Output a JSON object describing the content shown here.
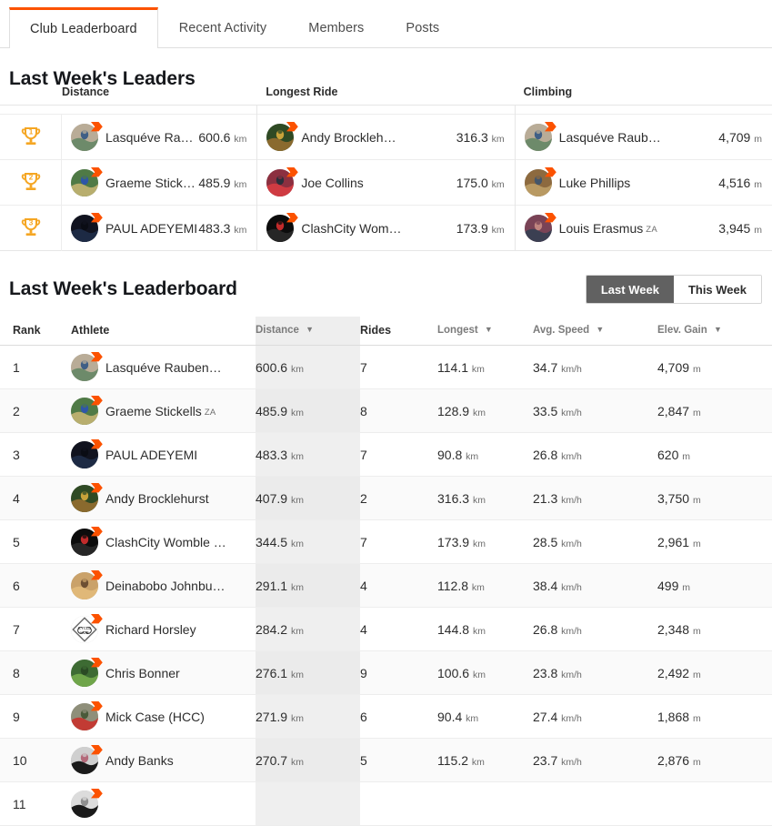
{
  "tabs": [
    {
      "label": "Club Leaderboard",
      "active": true
    },
    {
      "label": "Recent Activity",
      "active": false
    },
    {
      "label": "Members",
      "active": false
    },
    {
      "label": "Posts",
      "active": false
    }
  ],
  "leaders": {
    "title": "Last Week's Leaders",
    "columns": [
      {
        "header": "Distance",
        "unit": "km",
        "rows": [
          {
            "rank": 1,
            "name": "Lasquéve Raub…",
            "country": "",
            "value": "600.6",
            "unit": "km",
            "avatar": "road-cyclist"
          },
          {
            "rank": 2,
            "name": "Graeme Stickel…",
            "country": "",
            "value": "485.9",
            "unit": "km",
            "avatar": "group-ride"
          },
          {
            "rank": 3,
            "name": "PAUL ADEYEMI",
            "country": "",
            "value": "483.3",
            "unit": "km",
            "avatar": "dark-portrait"
          }
        ]
      },
      {
        "header": "Longest Ride",
        "unit": "km",
        "rows": [
          {
            "rank": 1,
            "name": "Andy Brockleh…",
            "country": "",
            "value": "316.3",
            "unit": "km",
            "avatar": "green-helmet"
          },
          {
            "rank": 2,
            "name": "Joe Collins",
            "country": "",
            "value": "175.0",
            "unit": "km",
            "avatar": "red-jersey"
          },
          {
            "rank": 3,
            "name": "ClashCity Wom…",
            "country": "",
            "value": "173.9",
            "unit": "km",
            "avatar": "black-logo"
          }
        ]
      },
      {
        "header": "Climbing",
        "unit": "m",
        "rows": [
          {
            "rank": 1,
            "name": "Lasquéve Raub…",
            "country": "",
            "value": "4,709",
            "unit": "m",
            "avatar": "road-cyclist"
          },
          {
            "rank": 2,
            "name": "Luke Phillips",
            "country": "",
            "value": "4,516",
            "unit": "m",
            "avatar": "gravel-rider"
          },
          {
            "rank": 3,
            "name": "Louis Erasmus",
            "country": "ZA",
            "value": "3,945",
            "unit": "m",
            "avatar": "couple-selfie"
          }
        ]
      }
    ]
  },
  "leaderboard": {
    "title": "Last Week's Leaderboard",
    "toggle": {
      "options": [
        {
          "label": "Last Week",
          "active": true
        },
        {
          "label": "This Week",
          "active": false
        }
      ]
    },
    "columns": [
      {
        "key": "rank",
        "label": "Rank",
        "sortable": false,
        "highlighted": false
      },
      {
        "key": "ath",
        "label": "Athlete",
        "sortable": false,
        "highlighted": false
      },
      {
        "key": "dist",
        "label": "Distance",
        "sortable": true,
        "highlighted": true
      },
      {
        "key": "rides",
        "label": "Rides",
        "sortable": false,
        "highlighted": false
      },
      {
        "key": "long",
        "label": "Longest",
        "sortable": true,
        "highlighted": false
      },
      {
        "key": "spd",
        "label": "Avg. Speed",
        "sortable": true,
        "highlighted": false
      },
      {
        "key": "elev",
        "label": "Elev. Gain",
        "sortable": true,
        "highlighted": false
      }
    ],
    "sort_arrow": "▼",
    "rows": [
      {
        "rank": "1",
        "name": "Lasquéve Rauben…",
        "country": "",
        "distance": "600.6",
        "distance_unit": "km",
        "rides": "7",
        "longest": "114.1",
        "longest_unit": "km",
        "speed": "34.7",
        "speed_unit": "km/h",
        "elev": "4,709",
        "elev_unit": "m",
        "avatar": "road-cyclist"
      },
      {
        "rank": "2",
        "name": "Graeme Stickells",
        "country": "ZA",
        "distance": "485.9",
        "distance_unit": "km",
        "rides": "8",
        "longest": "128.9",
        "longest_unit": "km",
        "speed": "33.5",
        "speed_unit": "km/h",
        "elev": "2,847",
        "elev_unit": "m",
        "avatar": "group-ride"
      },
      {
        "rank": "3",
        "name": "PAUL ADEYEMI",
        "country": "",
        "distance": "483.3",
        "distance_unit": "km",
        "rides": "7",
        "longest": "90.8",
        "longest_unit": "km",
        "speed": "26.8",
        "speed_unit": "km/h",
        "elev": "620",
        "elev_unit": "m",
        "avatar": "dark-portrait"
      },
      {
        "rank": "4",
        "name": "Andy Brocklehurst",
        "country": "",
        "distance": "407.9",
        "distance_unit": "km",
        "rides": "2",
        "longest": "316.3",
        "longest_unit": "km",
        "speed": "21.3",
        "speed_unit": "km/h",
        "elev": "3,750",
        "elev_unit": "m",
        "avatar": "green-helmet"
      },
      {
        "rank": "5",
        "name": "ClashCity Womble …",
        "country": "",
        "distance": "344.5",
        "distance_unit": "km",
        "rides": "7",
        "longest": "173.9",
        "longest_unit": "km",
        "speed": "28.5",
        "speed_unit": "km/h",
        "elev": "2,961",
        "elev_unit": "m",
        "avatar": "black-logo"
      },
      {
        "rank": "6",
        "name": "Deinabobo Johnbu…",
        "country": "",
        "distance": "291.1",
        "distance_unit": "km",
        "rides": "4",
        "longest": "112.8",
        "longest_unit": "km",
        "speed": "38.4",
        "speed_unit": "km/h",
        "elev": "499",
        "elev_unit": "m",
        "avatar": "sunset-rider"
      },
      {
        "rank": "7",
        "name": "Richard Horsley",
        "country": "",
        "distance": "284.2",
        "distance_unit": "km",
        "rides": "4",
        "longest": "144.8",
        "longest_unit": "km",
        "speed": "26.8",
        "speed_unit": "km/h",
        "elev": "2,348",
        "elev_unit": "m",
        "avatar": "cyclehub-logo"
      },
      {
        "rank": "8",
        "name": "Chris Bonner",
        "country": "",
        "distance": "276.1",
        "distance_unit": "km",
        "rides": "9",
        "longest": "100.6",
        "longest_unit": "km",
        "speed": "23.8",
        "speed_unit": "km/h",
        "elev": "2,492",
        "elev_unit": "m",
        "avatar": "green-outdoor"
      },
      {
        "rank": "9",
        "name": "Mick Case (HCC)",
        "country": "",
        "distance": "271.9",
        "distance_unit": "km",
        "rides": "6",
        "longest": "90.4",
        "longest_unit": "km",
        "speed": "27.4",
        "speed_unit": "km/h",
        "elev": "1,868",
        "elev_unit": "m",
        "avatar": "red-kit-rider"
      },
      {
        "rank": "10",
        "name": "Andy Banks",
        "country": "",
        "distance": "270.7",
        "distance_unit": "km",
        "rides": "5",
        "longest": "115.2",
        "longest_unit": "km",
        "speed": "23.7",
        "speed_unit": "km/h",
        "elev": "2,876",
        "elev_unit": "m",
        "avatar": "tt-rider"
      },
      {
        "rank": "11",
        "name": "",
        "country": "",
        "distance": "",
        "distance_unit": "",
        "rides": "",
        "longest": "",
        "longest_unit": "",
        "speed": "",
        "speed_unit": "",
        "elev": "",
        "elev_unit": "",
        "avatar": "partial-row"
      }
    ]
  },
  "colors": {
    "accent": "#fc5200",
    "trophy": "#f5a623",
    "toggle_active_bg": "#616161",
    "highlight_col": "#eeeeee",
    "text": "#2d2d2d"
  },
  "icons": {
    "trophy": "trophy-icon",
    "sort_desc": "chevron-down-icon",
    "badge": "strava-flag-badge-icon"
  }
}
